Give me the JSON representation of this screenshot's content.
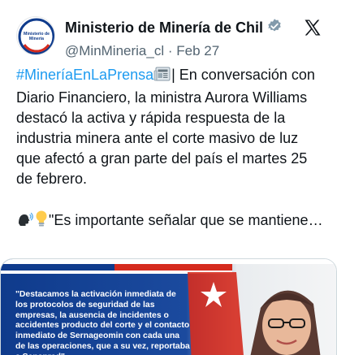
{
  "account": {
    "display_name": "Ministerio de Minería de Chil",
    "handle": "@MinMineria_cl",
    "separator": "·",
    "date": "Feb 27",
    "avatar_text_line1": "Ministerio de",
    "avatar_text_line2": "Minería"
  },
  "tweet": {
    "hashtag": "#MineríaEnLaPrensa",
    "newspaper_emoji": "📰",
    "paragraph1_rest": "| En conversación con Diario Financiero, la ministra Aurora Williams destacó la activa y rápida respuesta de la industria minera ante el corte masivo de luz que afectó a gran parte del país el martes 25 de febrero.",
    "speaking_emoji": "🗣",
    "bulb_emoji": "💡",
    "paragraph2": "\"Es importante señalar que se mantiene…"
  },
  "media": {
    "quote_text": "\"Destacamos la activación inmediata de los protocolos de seguridad de las empresas, la ausencia de incidentes o accidentes producto del corte y el contacto inmediato de Sernageomin con cada una de las operaciones, que a su vez, reportaba a Senapred\""
  },
  "colors": {
    "brand_blue": "#1d9bf0",
    "chile_blue": "#0f3b8c",
    "chile_red": "#d52b1e"
  },
  "icons": {
    "verified": "verified-badge-icon",
    "x_logo": "x-logo-icon"
  }
}
